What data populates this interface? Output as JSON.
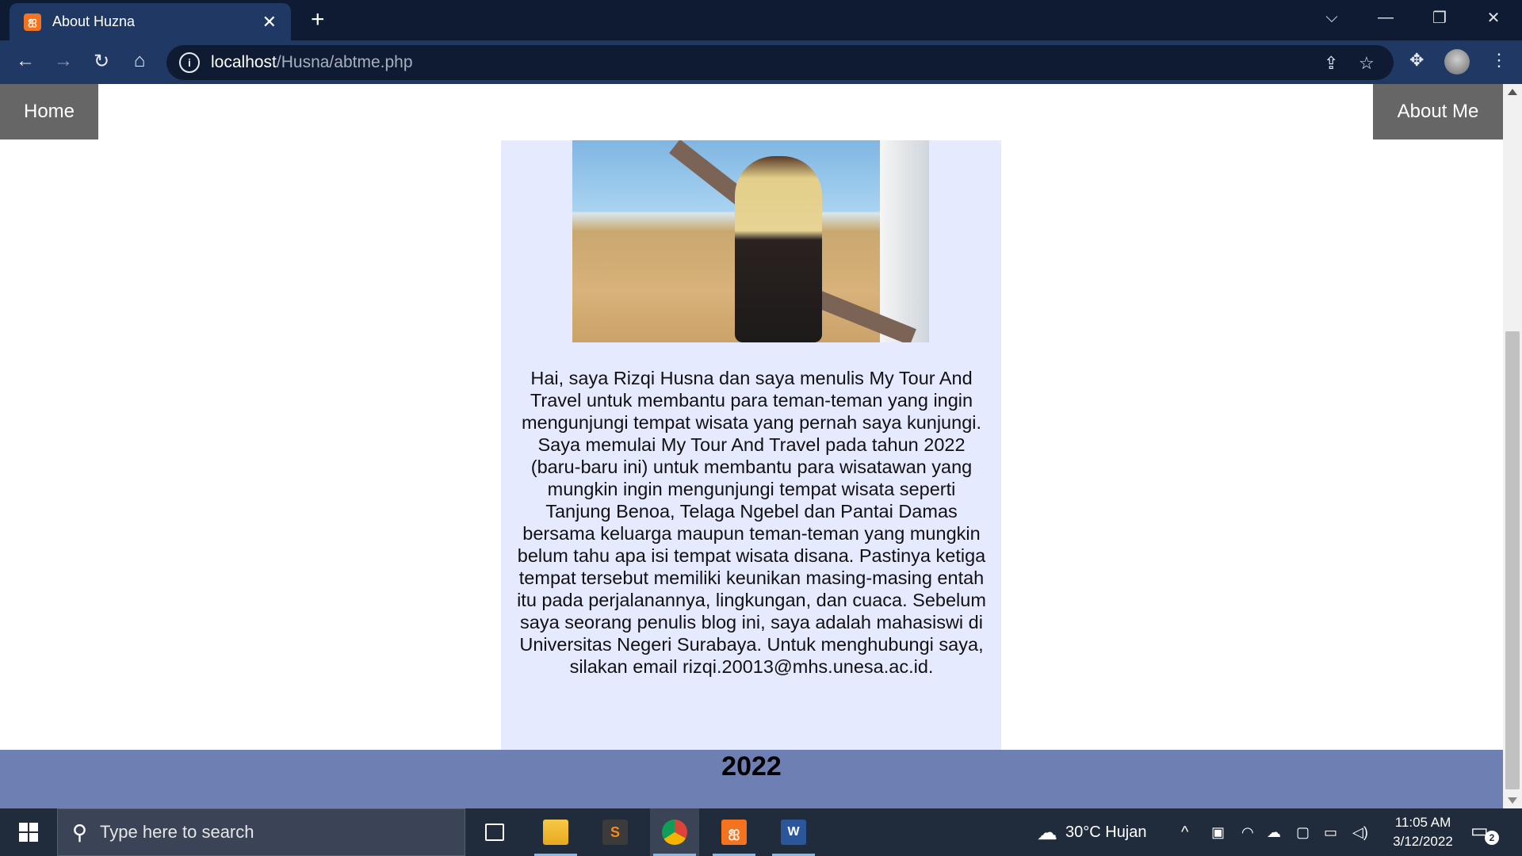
{
  "browser": {
    "tab_title": "About Huzna",
    "tab_close": "✕",
    "new_tab": "+",
    "url_host": "localhost",
    "url_path": "/Husna/abtme.php"
  },
  "nav": {
    "home": "Home",
    "about": "About Me"
  },
  "content": {
    "photo_alt": "Smiling woman in a hijab with arms outstretched on a sandy beach",
    "about_text": "Hai, saya Rizqi Husna dan saya menulis My Tour And Travel untuk membantu para teman-teman yang ingin mengunjungi tempat wisata yang pernah saya kunjungi. Saya memulai My Tour And Travel pada tahun 2022 (baru-baru ini) untuk membantu para wisatawan yang mungkin ingin mengunjungi tempat wisata seperti Tanjung Benoa, Telaga Ngebel dan Pantai Damas bersama keluarga maupun teman-teman yang mungkin belum tahu apa isi tempat wisata disana. Pastinya ketiga tempat tersebut memiliki keunikan masing-masing entah itu pada perjalanannya, lingkungan, dan cuaca. Sebelum saya seorang penulis blog ini, saya adalah mahasiswi di Universitas Negeri Surabaya. Untuk menghubungi saya, silakan email rizqi.20013@mhs.unesa.ac.id."
  },
  "footer": {
    "year": "2022"
  },
  "taskbar": {
    "search_placeholder": "Type here to search",
    "weather": "30°C  Hujan",
    "time": "11:05 AM",
    "date": "3/12/2022",
    "notification_count": "2"
  },
  "colors": {
    "content_bg": "#e6eaff",
    "footer_bg": "#6d7fb3",
    "nav_bg": "#666666"
  }
}
